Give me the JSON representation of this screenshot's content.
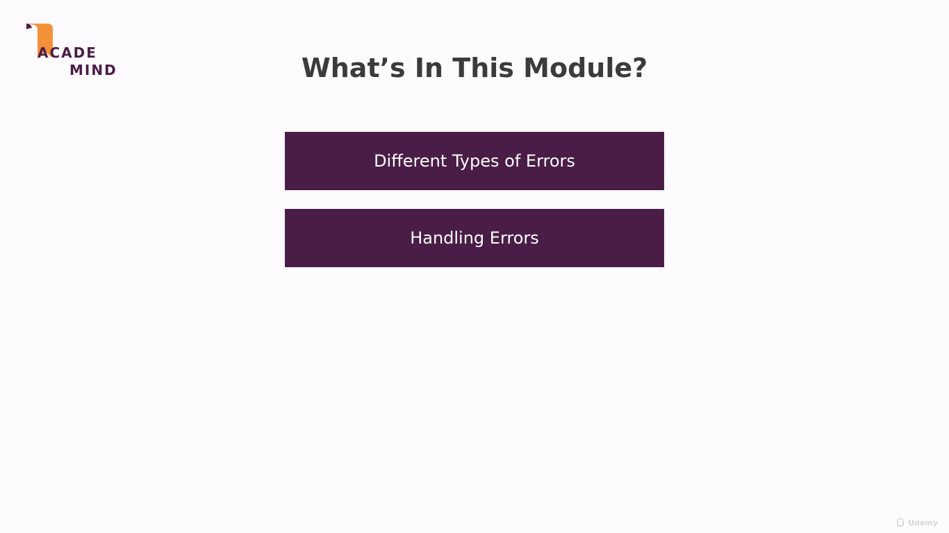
{
  "logo": {
    "line1": "ACADE",
    "line2": "MIND",
    "bookmark_color": "#f39138",
    "text_color": "#4a1d47"
  },
  "slide": {
    "title": "What’s In This Module?",
    "topics": [
      "Different Types of Errors",
      "Handling Errors"
    ],
    "topic_color": "#4a1d47"
  },
  "watermark": {
    "icon": "udemy-icon",
    "text": "Udemy"
  }
}
